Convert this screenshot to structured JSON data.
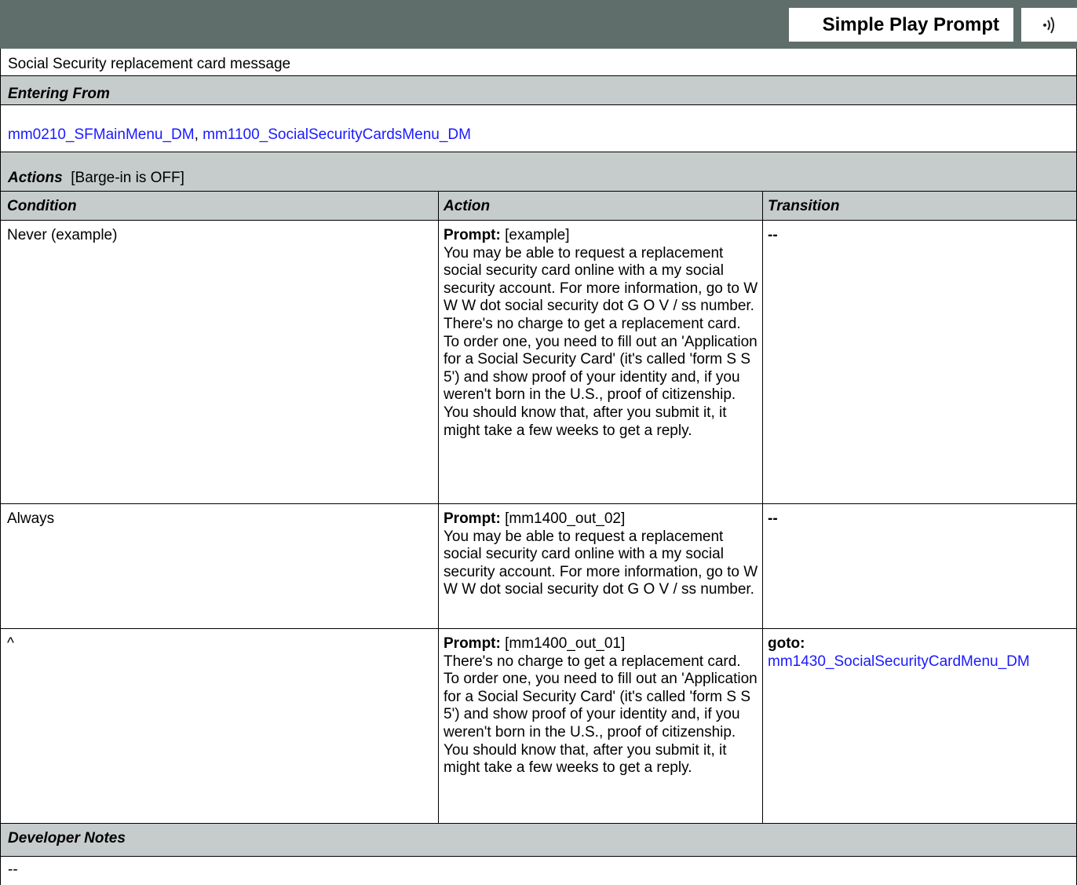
{
  "header": {
    "title": "Simple Play Prompt",
    "audio_icon": "speaker-icon"
  },
  "description": "Social Security replacement card message",
  "entering_from": {
    "label": "Entering From",
    "links": [
      "mm0210_SFMainMenu_DM",
      "mm1100_SocialSecurityCardsMenu_DM"
    ],
    "separator": ", "
  },
  "actions": {
    "label": "Actions",
    "barge_in": "[Barge-in is OFF]",
    "columns": [
      "Condition",
      "Action",
      "Transition"
    ],
    "rows": [
      {
        "condition": "Never (example)",
        "prompt_label": "Prompt:",
        "prompt_id": "[example]",
        "prompt_text": "You may be able to request a replacement social security card online with a my social security account. For more information, go to W W W dot social security dot G O V / ss number. There's no charge to get a replacement card. To order one, you need to fill out an 'Application for a Social Security Card' (it's called 'form S S 5') and show proof of your identity and, if you weren't born in the U.S., proof of citizenship. You should know that, after you submit it, it might take a few weeks to get a reply.",
        "transition_label": "--",
        "transition_link": ""
      },
      {
        "condition": "Always",
        "prompt_label": "Prompt:",
        "prompt_id": "[mm1400_out_02]",
        "prompt_text": "You may be able to request a replacement social security card online with a my social security account. For more information, go to W W W dot social security dot G O V / ss number.",
        "transition_label": "--",
        "transition_link": ""
      },
      {
        "condition": "^",
        "prompt_label": "Prompt:",
        "prompt_id": "[mm1400_out_01]",
        "prompt_text": "There's no charge to get a replacement card. To order one, you need to fill out an 'Application for a Social Security Card' (it's called 'form S S 5') and show proof of your identity and, if you weren't born in the U.S., proof of citizenship. You should know that, after you submit it, it might take a few weeks to get a reply.",
        "transition_label": "goto:",
        "transition_link": "mm1430_SocialSecurityCardMenu_DM"
      }
    ]
  },
  "developer_notes": {
    "label": "Developer Notes",
    "text": "--"
  },
  "colors": {
    "header_bg": "#5f6e6b",
    "section_bg": "#c6cccb",
    "link": "#1a1aff"
  }
}
